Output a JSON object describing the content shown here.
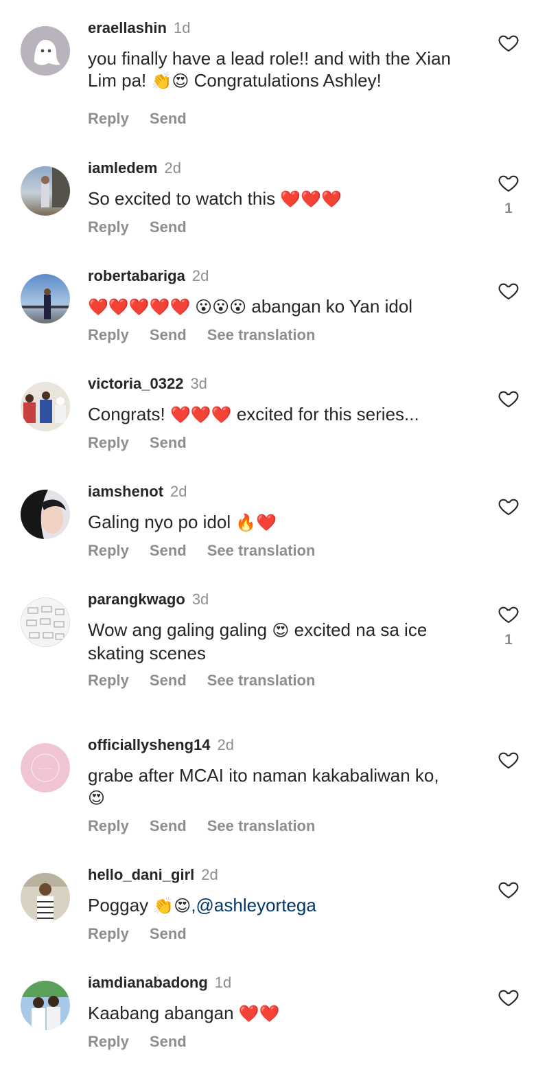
{
  "comments": [
    {
      "username": "eraellashin",
      "time": "1d",
      "line1": "you finally have a lead role!! and with the Xian",
      "line2_pre": "Lim pa! ",
      "emoji": "👏😍",
      "line2_post": " Congratulations Ashley!",
      "reply": "Reply",
      "send": "Send"
    },
    {
      "username": "iamledem",
      "time": "2d",
      "text": "So excited to watch this ",
      "emoji": "❤️❤️❤️",
      "reply": "Reply",
      "send": "Send",
      "likes": "1"
    },
    {
      "username": "robertabariga",
      "time": "2d",
      "emoji": "❤️❤️❤️❤️❤️ 😮😮😮",
      "text_post": " abangan ko Yan idol",
      "reply": "Reply",
      "send": "Send",
      "translate": "See translation"
    },
    {
      "username": "victoria_0322",
      "time": "3d",
      "text": "Congrats! ",
      "emoji": "❤️❤️❤️",
      "text_post": " excited for this series...",
      "reply": "Reply",
      "send": "Send"
    },
    {
      "username": "iamshenot",
      "time": "2d",
      "text": "Galing nyo po idol ",
      "emoji": "🔥❤️",
      "reply": "Reply",
      "send": "Send",
      "translate": "See translation"
    },
    {
      "username": "parangkwago",
      "time": "3d",
      "text": "Wow ang galing galing ",
      "emoji": "😍",
      "text_post": " excited na sa ice",
      "line2": "skating scenes",
      "reply": "Reply",
      "send": "Send",
      "translate": "See translation",
      "likes": "1"
    },
    {
      "username": "officiallysheng14",
      "time": "2d",
      "text": "grabe after MCAI ito  naman  kakabaliwan ko,",
      "emoji": "😍",
      "reply": "Reply",
      "send": "Send",
      "translate": "See translation"
    },
    {
      "username": "hello_dani_girl",
      "time": "2d",
      "text": "Poggay ",
      "emoji": "👏😍",
      "mention": ",@ashleyortega",
      "reply": "Reply",
      "send": "Send"
    },
    {
      "username": "iamdianabadong",
      "time": "1d",
      "text": "Kaabang abangan ",
      "emoji": "❤️❤️",
      "reply": "Reply",
      "send": "Send"
    }
  ],
  "icons": {
    "like": "heart-outline-icon"
  },
  "colors": {
    "text": "#262626",
    "muted": "#8e8e8e",
    "mention": "#00376b",
    "background": "#ffffff"
  }
}
